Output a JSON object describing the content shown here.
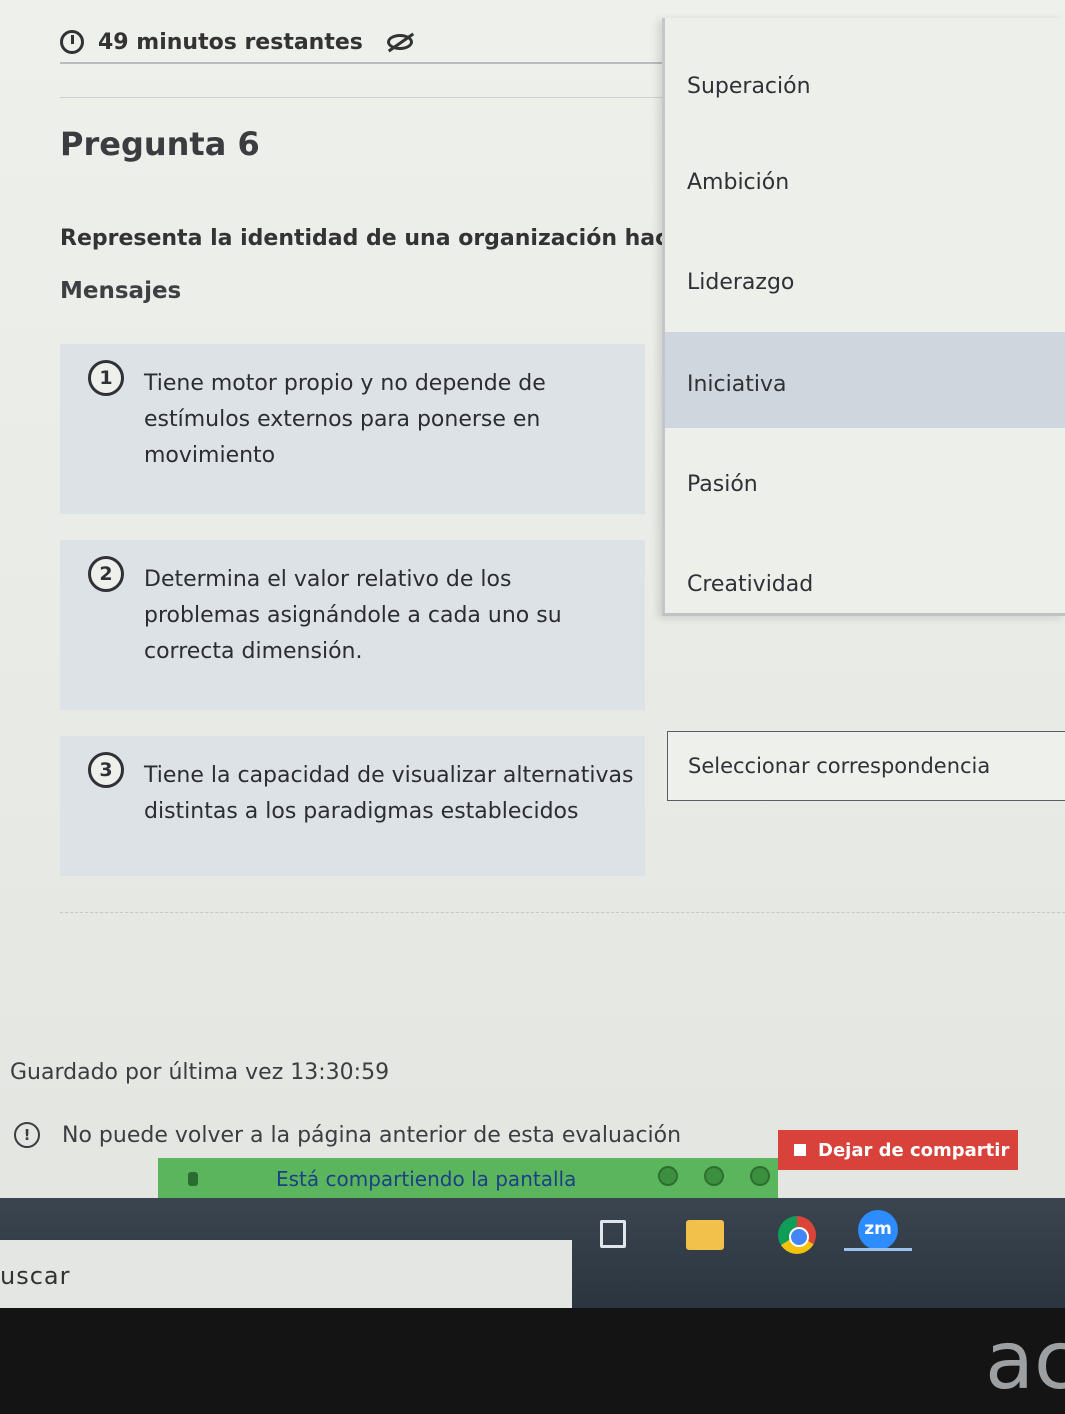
{
  "header": {
    "timer_text": "49 minutos restantes",
    "question_title": "Pregunta 6",
    "prompt": "Representa la identidad de una organización hacia",
    "messages_label": "Mensajes"
  },
  "messages": [
    {
      "num": "1",
      "text": "Tiene motor propio y no depende de estímulos externos para ponerse en movimiento"
    },
    {
      "num": "2",
      "text": "Determina el valor relativo de los problemas asignándole a cada uno su correcta dimensión."
    },
    {
      "num": "3",
      "text": "Tiene la capacidad de visualizar alternativas distintas a los paradigmas establecidos"
    }
  ],
  "dropdown": {
    "options": [
      "Superación",
      "Ambición",
      "Liderazgo",
      "Iniciativa",
      "Pasión",
      "Creatividad"
    ],
    "highlighted": "Iniciativa"
  },
  "select": {
    "value": "Seleccionar correspondencia"
  },
  "footer": {
    "saved": "Guardado por última vez 13:30:59",
    "warning": "No puede volver a la página anterior de esta evaluación"
  },
  "share": {
    "label": "Está compartiendo la pantalla",
    "stop_label": "Dejar de compartir"
  },
  "taskbar": {
    "search_fragment": "uscar",
    "zoom_label": "zm"
  },
  "bezel": {
    "logo_fragment": "ac"
  },
  "colors": {
    "share_green": "#5bb55d",
    "stop_red": "#d9413b",
    "highlight": "#cfd6dd"
  }
}
